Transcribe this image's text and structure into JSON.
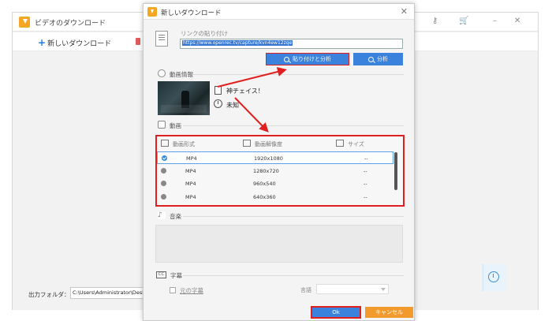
{
  "app": {
    "title": "ビデオのダウンロード",
    "new_download": "新しいダウンロード",
    "output_folder_label": "出力フォルダ：",
    "output_folder_path": "C:\\Users\\Administrator\\Desktop"
  },
  "dialog": {
    "title": "新しいダウンロード",
    "link_label": "リンクの貼り付け",
    "url": "https://www.openrec.tv/capture/kvn4ew12zqe",
    "paste_analyze": "貼り付けと分析",
    "analyze": "分析",
    "video_info_label": "動画情報",
    "video_title": "神チェイス！",
    "duration": "未知",
    "video_section_label": "動画",
    "columns": {
      "format": "動画形式",
      "resolution": "動画解像度",
      "size": "サイズ"
    },
    "rows": [
      {
        "format": "MP4",
        "resolution": "1920x1080",
        "size": "--",
        "selected": true
      },
      {
        "format": "MP4",
        "resolution": "1280x720",
        "size": "--",
        "selected": false
      },
      {
        "format": "MP4",
        "resolution": "960x540",
        "size": "--",
        "selected": false
      },
      {
        "format": "MP4",
        "resolution": "640x360",
        "size": "--",
        "selected": false
      }
    ],
    "audio_label": "音楽",
    "subtitle_label": "字幕",
    "original_subtitle": "元の字幕",
    "language_label": "言語",
    "ok": "Ok",
    "cancel": "キャンセル"
  },
  "colors": {
    "accent_blue": "#3a82dc",
    "highlight_red": "#e02020",
    "cancel_orange": "#f39a2d",
    "logo_orange": "#f5a623"
  }
}
